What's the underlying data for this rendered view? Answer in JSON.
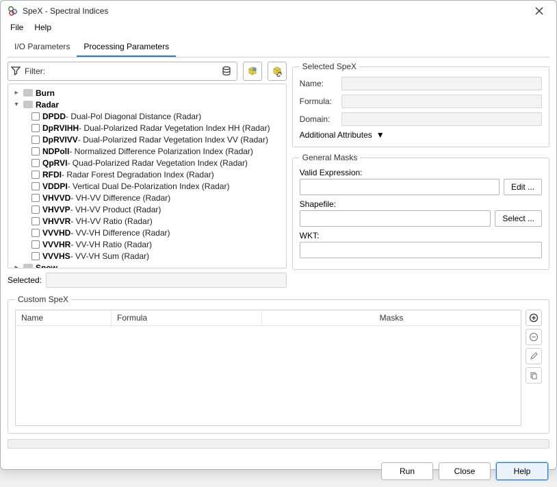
{
  "window_title": "SpeX - Spectral Indices",
  "menubar": {
    "file": "File",
    "help": "Help"
  },
  "tabs": {
    "io": "I/O Parameters",
    "proc": "Processing Parameters"
  },
  "filter": {
    "label": "Filter:",
    "value": ""
  },
  "tree": {
    "burn": {
      "label": "Burn"
    },
    "radar": {
      "label": "Radar",
      "items": [
        {
          "abbr": "DPDD",
          "desc": " - Dual-Pol Diagonal Distance (Radar)"
        },
        {
          "abbr": "DpRVIHH",
          "desc": " - Dual-Polarized Radar Vegetation Index HH (Radar)"
        },
        {
          "abbr": "DpRVIVV",
          "desc": " - Dual-Polarized Radar Vegetation Index VV (Radar)"
        },
        {
          "abbr": "NDPolI",
          "desc": " - Normalized Difference Polarization Index (Radar)"
        },
        {
          "abbr": "QpRVI",
          "desc": " - Quad-Polarized Radar Vegetation Index (Radar)"
        },
        {
          "abbr": "RFDI",
          "desc": " - Radar Forest Degradation Index (Radar)"
        },
        {
          "abbr": "VDDPI",
          "desc": " - Vertical Dual De-Polarization Index (Radar)"
        },
        {
          "abbr": "VHVVD",
          "desc": " - VH-VV Difference (Radar)"
        },
        {
          "abbr": "VHVVP",
          "desc": " - VH-VV Product (Radar)"
        },
        {
          "abbr": "VHVVR",
          "desc": " - VH-VV Ratio (Radar)"
        },
        {
          "abbr": "VVVHD",
          "desc": " - VV-VH Difference (Radar)"
        },
        {
          "abbr": "VVVHR",
          "desc": " - VV-VH Ratio (Radar)"
        },
        {
          "abbr": "VVVHS",
          "desc": " - VV-VH Sum (Radar)"
        }
      ]
    },
    "snow": {
      "label": "Snow"
    }
  },
  "selected": {
    "label": "Selected:",
    "value": ""
  },
  "selected_spex": {
    "legend": "Selected SpeX",
    "name_label": "Name:",
    "formula_label": "Formula:",
    "domain_label": "Domain:",
    "addattr": "Additional Attributes"
  },
  "masks": {
    "legend": "General Masks",
    "valid_label": "Valid Expression:",
    "edit_btn": "Edit ...",
    "shapefile_label": "Shapefile:",
    "select_btn": "Select ...",
    "wkt_label": "WKT:"
  },
  "custom": {
    "legend": "Custom SpeX",
    "cols": {
      "name": "Name",
      "formula": "Formula",
      "masks": "Masks"
    }
  },
  "footer": {
    "run": "Run",
    "close": "Close",
    "help": "Help"
  }
}
